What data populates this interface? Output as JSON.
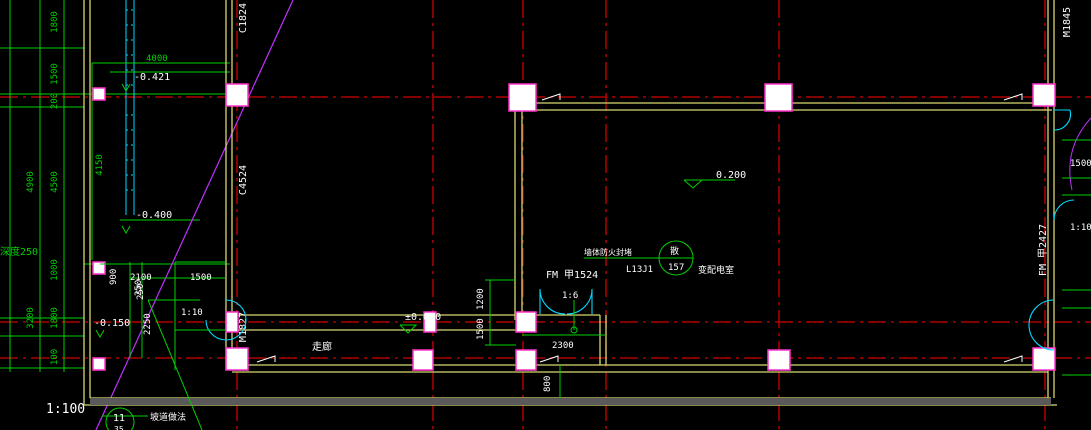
{
  "drawing": {
    "scale_label": "1:100",
    "left_dims": [
      "1800",
      "1500",
      "200",
      "4500",
      "1000",
      "1800",
      "100",
      "4900",
      "3200",
      "4150"
    ],
    "dims_top": {
      "d4000": "4000",
      "e421": "-0.421",
      "e400": "-0.400",
      "d250top": "250",
      "d900": "900",
      "d2100": "2100",
      "d1500": "1500"
    },
    "door_labels": {
      "c1824": "C1824",
      "c4524": "C4524",
      "m1827": "M1827",
      "m1845": "M1845",
      "fm2427": "FM 甲2427",
      "fm1524": "FM 甲1524"
    },
    "room_labels": {
      "corridor": "走廊",
      "power_room": "变配电室",
      "fire_note": "墙体防火封堵"
    },
    "elevations": {
      "e0200": "0.200",
      "e0000": "±0.000",
      "e0150": "-0.150"
    },
    "dims_inner": {
      "d1200": "1200",
      "d1500b": "1500",
      "d2300": "2300",
      "d800": "800",
      "d2250": "2250",
      "d250": "250"
    },
    "slopes": {
      "s110a": "1:10",
      "s110b": "1:10",
      "s16": "1:6"
    },
    "right_dims": {
      "d1500r": "1500"
    },
    "callouts": {
      "l13j1": "L13J1",
      "circle_top": "散",
      "circle_bottom": "157",
      "c11": "11",
      "c11_text": "坡道做法",
      "c11_bottom": "35"
    }
  },
  "colors": {
    "background": "#000000",
    "grid_red": "#e00000",
    "wall_yellow": "#d8d870",
    "dim_green": "#00e000",
    "dim_cyan": "#00d8ff",
    "magenta": "#cc33ff",
    "column_fill": "#ffffff",
    "column_outline": "#ff33cc",
    "label_white": "#ffffff"
  }
}
